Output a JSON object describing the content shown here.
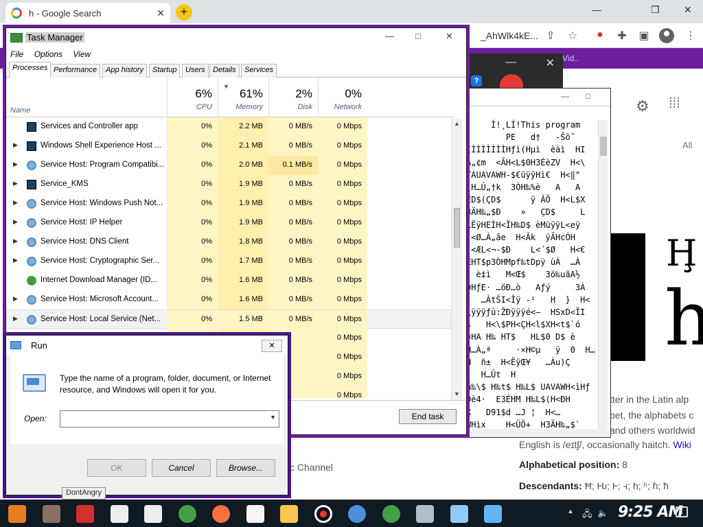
{
  "chrome": {
    "tab_title": "h - Google Search",
    "tab_close": "✕",
    "new_tab": "+",
    "url_fragment": "_AhWlk4kE...",
    "purple_bar_text": "rn Vid..",
    "all_label": "All",
    "minimize": "—",
    "restore": "❐",
    "close": "✕"
  },
  "knowledge": {
    "heading_letter": "Ḩ",
    "big_letter": "h",
    "line1": "tter in the Latin alp",
    "line2": "bet, the alphabets c",
    "line3": "and others worldwid",
    "line4": "English is /eɪtʃ/, occasionally haitch.",
    "line4_link": "Wiki",
    "alphabetical_label": "Alphabetical position:",
    "alphabetical_value": "8",
    "descendants_label": "Descendants:",
    "descendants_value": "Ħ; Ƕ; Ⱶ; ꟶ; h; ʰ; ɦ; ħ"
  },
  "bg_channel_text": "c Channel",
  "code_lines": [
    "     Í!¸LÍ!This program",
    "        PE   d†   -Šö˜",
    "ÌÌÌÌÌÌÌÌHƒì(Hµì  èàì  HI",
    "À„¢m  <ÃH<L$0H3ÈèZV  H<\\",
    "TAUAVAWH-$€üÿÿHì€  H<‖\"",
    " H…Û„†k  3ÒH‰%è   A   A",
    "ËD$(ÇD$      ÿ ÂÖ  H<L$X",
    "3ÄH‰„$Ð    »   ÇD$     L",
    "LËÿHEÌH<ÏH‰D$ èMüÿÿL<eÿ",
    " <Ø…À„âe  H<Ãk  ÿÃHcÓH",
    " <ÆL<¬-$Ð    L<´$Ø   H<€",
    "ÆHT$p3ÒHMpf‰tDpÿ ùÀ  …À",
    "  è‡ì   M<Œ$    3ö‰uãA½",
    "ÐHƒE· …öÐ…ò   Aƒý     3À",
    "¹  …ÀtŠI<Îÿ -¹   H  }  H<",
    "\\ÿÿÿƒù:ŽÐÿÿÿé<–  HSxD<ÏI",
    "š   H<\\$PH<ÇH<l$XH<t$`ó",
    "¤HA H‰ HT$   HL$0 D$ è",
    "H…À„ª     ·×H©µ   ÿ  0  H…",
    "H  ñ±  H<ËÿŒ¥   …Àu)Ç",
    "   H…Ût  H",
    "ñ‰\\$ H‰t$ H‰L$ UAVAWH<ìHƒ",
    "0è4·  E3ÉHM H‰L$(H<ÐH",
    "X   D91$d …J ¦  H<… ",
    "WHìx    H<ÜÖ+  H3ÄH‰„$`"
  ],
  "task_manager": {
    "title": "Task Manager",
    "menu": [
      "File",
      "Options",
      "View"
    ],
    "tabs": [
      "Processes",
      "Performance",
      "App history",
      "Startup",
      "Users",
      "Details",
      "Services"
    ],
    "columns": {
      "name": "Name",
      "cpu_pct": "6%",
      "cpu": "CPU",
      "memory_pct": "61%",
      "memory": "Memory",
      "disk_pct": "2%",
      "disk": "Disk",
      "network_pct": "0%",
      "network": "Network"
    },
    "rows": [
      {
        "name": "Services and Controller app",
        "cpu": "0%",
        "memory": "2.2 MB",
        "disk": "0 MB/s",
        "network": "0 Mbps",
        "icon": "window-icon",
        "expand": false
      },
      {
        "name": "Windows Shell Experience Host ...",
        "cpu": "0%",
        "memory": "2.1 MB",
        "disk": "0 MB/s",
        "network": "0 Mbps",
        "icon": "window-icon",
        "expand": true
      },
      {
        "name": "Service Host: Program Compatibi...",
        "cpu": "0%",
        "memory": "2.0 MB",
        "disk": "0.1 MB/s",
        "network": "0 Mbps",
        "icon": "gear-icon",
        "expand": true
      },
      {
        "name": "Service_KMS",
        "cpu": "0%",
        "memory": "1.9 MB",
        "disk": "0 MB/s",
        "network": "0 Mbps",
        "icon": "window-icon",
        "expand": true
      },
      {
        "name": "Service Host: Windows Push Not...",
        "cpu": "0%",
        "memory": "1.9 MB",
        "disk": "0 MB/s",
        "network": "0 Mbps",
        "icon": "gear-icon",
        "expand": true
      },
      {
        "name": "Service Host: IP Helper",
        "cpu": "0%",
        "memory": "1.9 MB",
        "disk": "0 MB/s",
        "network": "0 Mbps",
        "icon": "gear-icon",
        "expand": true
      },
      {
        "name": "Service Host: DNS Client",
        "cpu": "0%",
        "memory": "1.8 MB",
        "disk": "0 MB/s",
        "network": "0 Mbps",
        "icon": "gear-icon",
        "expand": true
      },
      {
        "name": "Service Host: Cryptographic Ser...",
        "cpu": "0%",
        "memory": "1.7 MB",
        "disk": "0 MB/s",
        "network": "0 Mbps",
        "icon": "gear-icon",
        "expand": true
      },
      {
        "name": "Internet Download Manager (ID...",
        "cpu": "0%",
        "memory": "1.6 MB",
        "disk": "0 MB/s",
        "network": "0 Mbps",
        "icon": "globe-icon",
        "expand": false
      },
      {
        "name": "Service Host: Microsoft Account...",
        "cpu": "0%",
        "memory": "1.6 MB",
        "disk": "0 MB/s",
        "network": "0 Mbps",
        "icon": "gear-icon",
        "expand": true
      },
      {
        "name": "Service Host: Local Service (Net...",
        "cpu": "0%",
        "memory": "1.5 MB",
        "disk": "0 MB/s",
        "network": "0 Mbps",
        "icon": "gear-icon",
        "expand": true
      },
      {
        "name": "",
        "cpu": "",
        "memory": "",
        "disk": "",
        "network": "0 Mbps",
        "icon": "",
        "expand": false
      },
      {
        "name": "",
        "cpu": "",
        "memory": "",
        "disk": "",
        "network": "0 Mbps",
        "icon": "",
        "expand": false
      },
      {
        "name": "",
        "cpu": "",
        "memory": "",
        "disk": "",
        "network": "0 Mbps",
        "icon": "",
        "expand": false
      },
      {
        "name": "",
        "cpu": "",
        "memory": "",
        "disk": "",
        "network": "0 Mbps",
        "icon": "",
        "expand": false
      }
    ],
    "end_task": "End task"
  },
  "run": {
    "title": "Run",
    "close": "✕",
    "description": "Type the name of a program, folder, document, or Internet resource, and Windows will open it for you.",
    "open_label": "Open:",
    "open_value": "",
    "ok": "OK",
    "cancel": "Cancel",
    "browse": "Browse..."
  },
  "tooltip": "DontAngry",
  "taskbar": {
    "clock": "9:25 AM",
    "notification_count": "1",
    "apps": [
      "start-icon",
      "character-icon",
      "angry-bird-icon",
      "cow-icon",
      "cow-icon",
      "chrome-icon",
      "firefox-icon",
      "7zip-icon",
      "folder-icon",
      "record-icon",
      "qbittorrent-icon",
      "chrome-icon",
      "picture-icon",
      "notepad-icon",
      "window-icon"
    ]
  }
}
